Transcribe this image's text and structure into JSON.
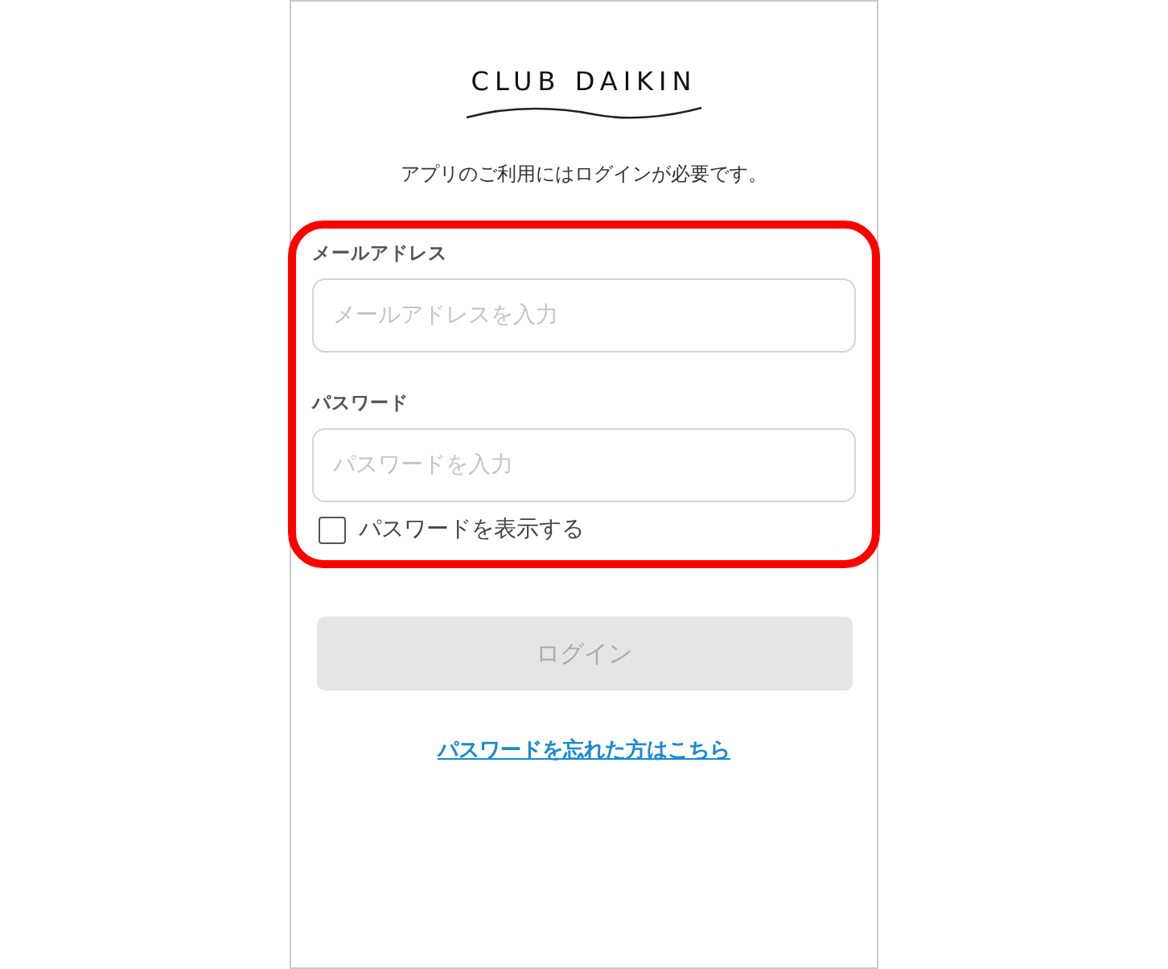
{
  "logo": {
    "text": "CLUB DAIKIN"
  },
  "subtitle": "アプリのご利用にはログインが必要です。",
  "form": {
    "highlighted": true,
    "fields": [
      {
        "label": "メールアドレス",
        "placeholder": "メールアドレスを入力"
      },
      {
        "label": "パスワード",
        "placeholder": "パスワードを入力"
      }
    ],
    "show_password": {
      "label": "パスワードを表示する",
      "checked": false
    }
  },
  "login_button": {
    "label": "ログイン",
    "disabled": true
  },
  "forgot_link": "パスワードを忘れた方はこちら"
}
